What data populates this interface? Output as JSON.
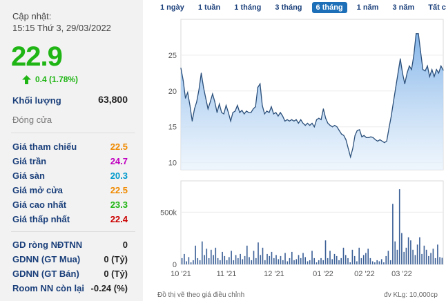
{
  "left": {
    "update_label": "Cập nhật:",
    "update_time": "15:15 Thứ 3, 29/03/2022",
    "price": "22.9",
    "change": "0.4 (1.78%)",
    "volume_label": "Khối lượng",
    "volume_value": "63,800",
    "status": "Đóng cửa",
    "ref_label": "Giá tham chiếu",
    "ref_value": "22.5",
    "ceil_label": "Giá trần",
    "ceil_value": "24.7",
    "floor_label": "Giá sàn",
    "floor_value": "20.3",
    "open_label": "Giá mở cửa",
    "open_value": "22.5",
    "high_label": "Giá cao nhất",
    "high_value": "23.3",
    "low_label": "Giá thấp nhất",
    "low_value": "22.4",
    "gd_label": "GD ròng NĐTNN",
    "gd_value": "0",
    "buy_label": "GDNN (GT Mua)",
    "buy_value": "0 (Tỷ)",
    "sell_label": "GDNN (GT Bán)",
    "sell_value": "0 (Tỷ)",
    "room_label": "Room NN còn lại",
    "room_value": "-0.24 (%)"
  },
  "tabs": [
    "1 ngày",
    "1 tuần",
    "1 tháng",
    "3 tháng",
    "6 tháng",
    "1 năm",
    "3 năm",
    "Tất cả"
  ],
  "active_tab": "6 tháng",
  "footer": {
    "note": "Đồ thị vẽ theo giá điều chỉnh",
    "unit": "đv KLg: 10,000cp"
  },
  "colors": {
    "up": "#1fb514",
    "accent": "#1d6fb8",
    "line": "#2b4f7a"
  },
  "chart_data": [
    {
      "type": "area",
      "ylim": [
        9,
        30
      ],
      "yticks": [
        "10",
        "15",
        "20",
        "25"
      ],
      "x_tick_labels": [
        "10 '21",
        "11 '21",
        "12 '21",
        "01 '22",
        "02 '22",
        "03 '22"
      ],
      "values": [
        23.2,
        21.5,
        19.0,
        19.8,
        18.0,
        15.8,
        17.5,
        18.5,
        20.2,
        22.5,
        20.5,
        19.0,
        17.5,
        18.5,
        19.6,
        18.5,
        17.0,
        18.2,
        17.0,
        16.8,
        18.0,
        17.0,
        15.8,
        17.0,
        17.2,
        18.0,
        17.0,
        17.3,
        16.8,
        17.2,
        17.0,
        17.0,
        17.5,
        17.8,
        20.5,
        21.0,
        18.0,
        16.8,
        17.2,
        17.0,
        17.8,
        16.8,
        17.0,
        16.5,
        17.0,
        16.5,
        15.8,
        16.0,
        15.8,
        16.0,
        15.8,
        16.0,
        15.5,
        16.0,
        15.5,
        15.2,
        15.5,
        15.2,
        15.5,
        15.0,
        16.0,
        16.2,
        16.0,
        17.5,
        16.2,
        15.5,
        15.2,
        15.0,
        15.2,
        15.0,
        14.5,
        14.0,
        13.8,
        13.2,
        12.0,
        10.8,
        12.0,
        13.8,
        14.5,
        14.6,
        13.6,
        13.8,
        13.5,
        13.5,
        13.6,
        13.5,
        13.2,
        13.0,
        13.2,
        13.0,
        12.8,
        13.0,
        14.8,
        16.5,
        18.5,
        20.5,
        22.5,
        24.5,
        22.5,
        21.0,
        22.5,
        23.5,
        23.0,
        25.0,
        28.0,
        28.0,
        25.5,
        23.0,
        22.8,
        23.5,
        22.0,
        23.0,
        22.0,
        23.0,
        22.5,
        23.5,
        22.9
      ]
    },
    {
      "type": "bar",
      "yticks": [
        "0",
        "500k"
      ],
      "ylim": [
        0,
        800000
      ],
      "values": [
        60000,
        100000,
        30000,
        70000,
        20000,
        40000,
        180000,
        60000,
        40000,
        220000,
        90000,
        150000,
        60000,
        140000,
        90000,
        160000,
        60000,
        40000,
        120000,
        80000,
        40000,
        70000,
        130000,
        40000,
        90000,
        60000,
        100000,
        50000,
        80000,
        180000,
        70000,
        40000,
        130000,
        60000,
        210000,
        90000,
        160000,
        40000,
        100000,
        80000,
        120000,
        60000,
        90000,
        50000,
        80000,
        40000,
        110000,
        30000,
        60000,
        120000,
        40000,
        50000,
        90000,
        60000,
        110000,
        70000,
        30000,
        40000,
        130000,
        60000,
        20000,
        40000,
        60000,
        40000,
        230000,
        60000,
        130000,
        50000,
        100000,
        80000,
        40000,
        60000,
        160000,
        90000,
        60000,
        20000,
        140000,
        80000,
        30000,
        160000,
        60000,
        90000,
        110000,
        150000,
        60000,
        30000,
        20000,
        40000,
        30000,
        50000,
        20000,
        80000,
        130000,
        40000,
        580000,
        220000,
        140000,
        720000,
        300000,
        120000,
        160000,
        260000,
        230000,
        140000,
        90000,
        190000,
        260000,
        100000,
        180000,
        140000,
        80000,
        110000,
        150000,
        60000,
        190000,
        70000,
        63800
      ]
    }
  ]
}
